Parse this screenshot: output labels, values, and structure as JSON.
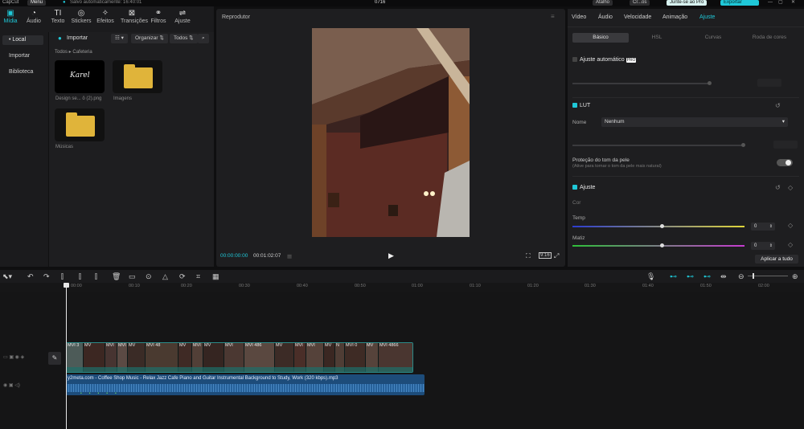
{
  "app": {
    "logo": "CapCut",
    "menu": "Menu",
    "autosave": "Salvo automaticamente: 16:40:01",
    "project_name": "0716",
    "shortcuts": "Atalho",
    "user": "Cr...os",
    "pro": "Junte-se ao Pro",
    "export": "Exportar"
  },
  "tools": [
    {
      "label": "Mídia",
      "icon": "media-icon"
    },
    {
      "label": "Áudio",
      "icon": "audio-icon"
    },
    {
      "label": "Texto",
      "icon": "text-icon"
    },
    {
      "label": "Stickers",
      "icon": "sticker-icon"
    },
    {
      "label": "Efeitos",
      "icon": "effects-icon"
    },
    {
      "label": "Transições",
      "icon": "transition-icon"
    },
    {
      "label": "Filtros",
      "icon": "filter-icon"
    },
    {
      "label": "Ajuste",
      "icon": "adjust-icon"
    }
  ],
  "leftnav": {
    "local": "• Local",
    "import": "Importar",
    "library": "Biblioteca"
  },
  "media": {
    "import_btn": "Importar",
    "organize": "Organizar",
    "all": "Todos",
    "breadcrumb": "Todos ▸ Cafeteria",
    "items": [
      {
        "name": "Design se... ô (2).png",
        "thumb_text": "Karel"
      },
      {
        "name": "Imagens"
      },
      {
        "name": "Músicas"
      }
    ]
  },
  "player": {
    "title": "Reprodutor",
    "current": "00:00:00:00",
    "duration": "00:01:02:07",
    "ratio": "Proporção",
    "ratio_val": "9:16"
  },
  "inspector": {
    "tabs": [
      "Vídeo",
      "Áudio",
      "Velocidade",
      "Animação",
      "Ajuste"
    ],
    "subtabs": [
      "Básico",
      "HSL",
      "Curvas",
      "Roda de cores"
    ],
    "auto_adjust": "Ajuste automático",
    "pro_badge": "PRO",
    "lut": "LUT",
    "name_label": "Nome",
    "name_value": "Nenhum",
    "skin_title": "Proteção do tom da pele",
    "skin_desc": "(Ative para tornar o tom da pele mais natural)",
    "adjust": "Ajuste",
    "color": "Cor",
    "temp": "Temp",
    "temp_val": "0",
    "tint": "Matiz",
    "tint_val": "0",
    "apply_all": "Aplicar a tudo"
  },
  "ruler": [
    "00:00",
    "00:10",
    "00:20",
    "00:30",
    "00:40",
    "00:50",
    "01:00",
    "01:10",
    "01:20",
    "01:30",
    "01:40",
    "01:50",
    "02:00"
  ],
  "video_clips": [
    "MVI 3",
    "MV",
    "MVI",
    "MVI",
    "MV",
    "MVI 48",
    "MV",
    "MVI",
    "MV",
    "MVI",
    "MVI 486",
    "MV",
    "MVI",
    "MVI",
    "MV",
    "N",
    "MVI 0",
    "MV",
    "MVI 4866"
  ],
  "audio_clip": "y2meta.com - Coffee Shop Music - Relax Jazz Cafe Piano and Guitar Instrumental Background to Study, Work (320 kbps).mp3"
}
